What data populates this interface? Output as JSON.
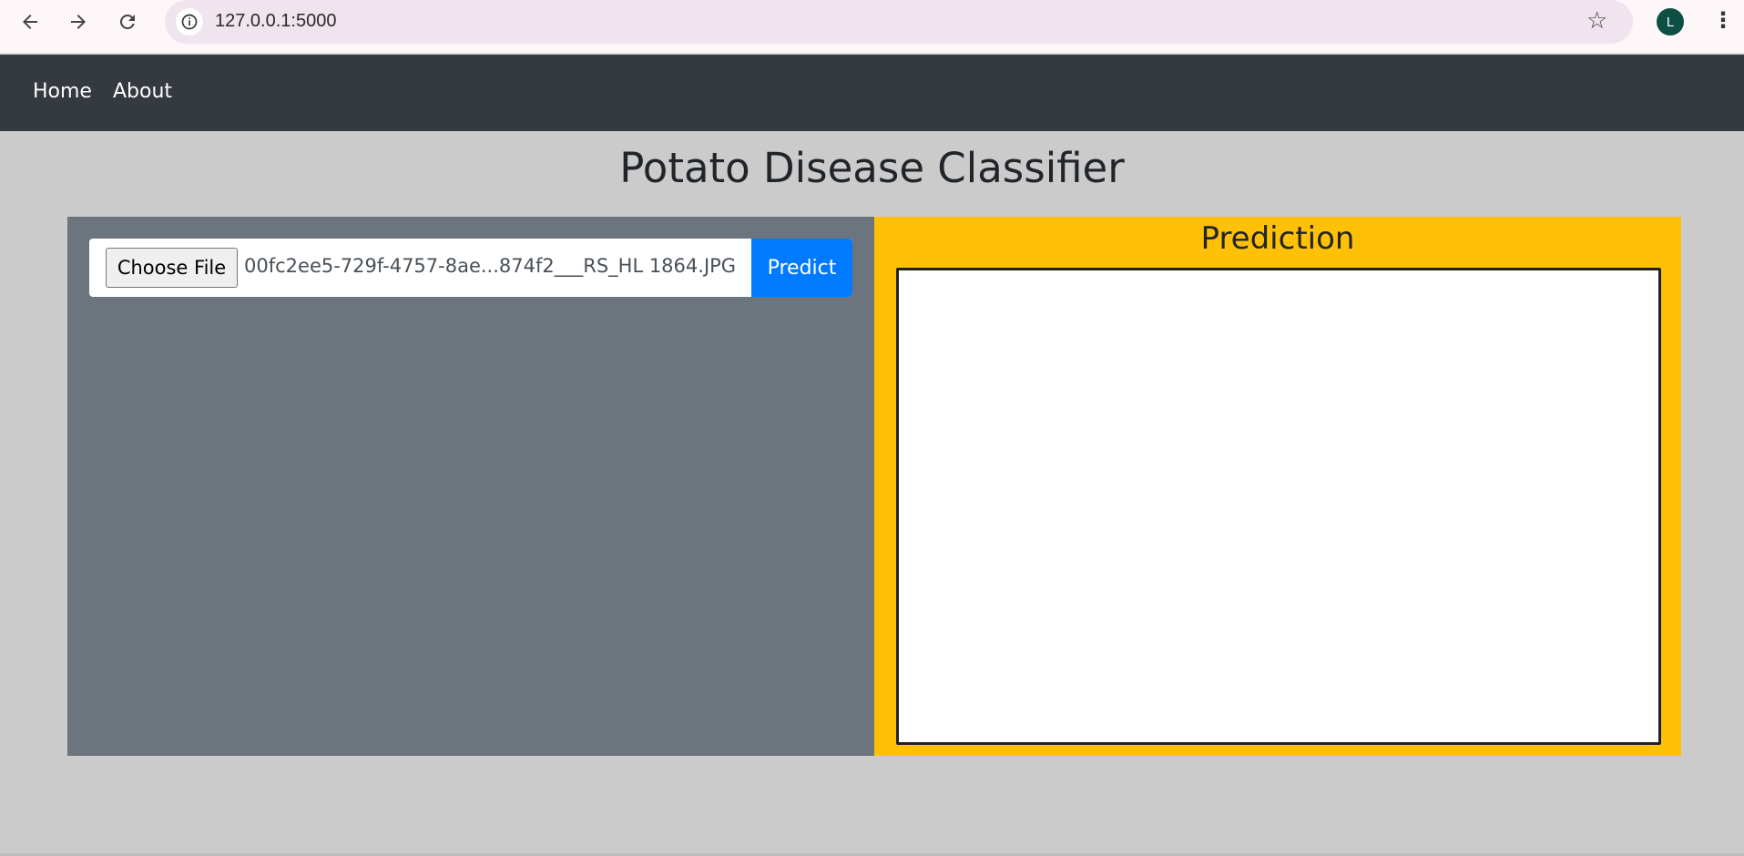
{
  "browser": {
    "back_icon": "arrow-left-icon",
    "forward_icon": "arrow-right-icon",
    "reload_icon": "reload-icon",
    "site_info_icon": "info-icon",
    "url": "127.0.0.1:5000",
    "bookmark_icon": "star-icon",
    "profile_initial": "L",
    "profile_color": "#0d4f43",
    "menu_icon": "kebab-menu-icon"
  },
  "navbar": {
    "background": "#343a40",
    "links": [
      "Home",
      "About"
    ]
  },
  "page": {
    "title": "Potato Disease Classifier",
    "background": "#cbcbcb"
  },
  "upload": {
    "choose_file_label": "Choose File",
    "file_name": "00fc2ee5-729f-4757-8ae...874f2___RS_HL 1864.JPG",
    "predict_label": "Predict",
    "predict_color": "#007bff",
    "panel_color": "#6c757d"
  },
  "prediction": {
    "title": "Prediction",
    "panel_color": "#ffc107",
    "result": ""
  }
}
